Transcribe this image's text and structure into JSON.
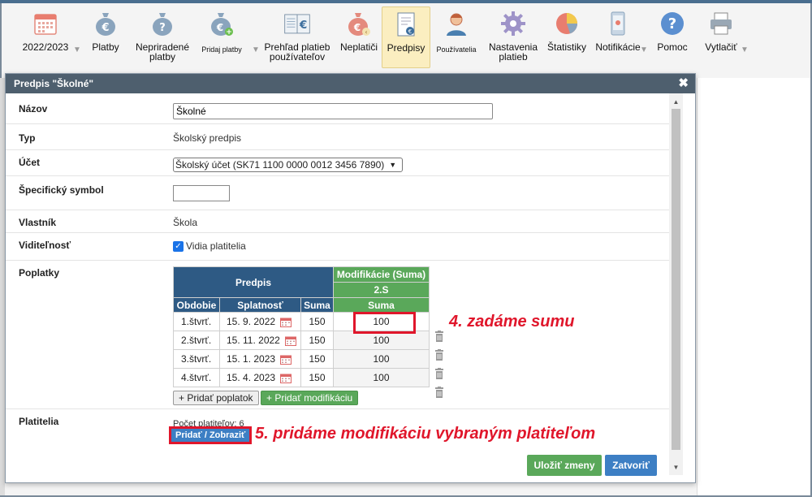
{
  "toolbar": {
    "items": [
      {
        "label": "2022/2023",
        "icon": "calendar-icon",
        "caret": true
      },
      {
        "label": "Platby",
        "icon": "money-bag-euro-icon"
      },
      {
        "label": "Nepriradené platby",
        "icon": "money-bag-question-icon"
      },
      {
        "label": "Pridaj platby",
        "icon": "money-bag-add-icon",
        "caret": true
      },
      {
        "label": "Prehľad platieb používateľov",
        "icon": "ledger-euro-icon"
      },
      {
        "label": "Neplatiči",
        "icon": "money-bag-back-icon"
      },
      {
        "label": "Predpisy",
        "icon": "document-euro-icon",
        "active": true
      },
      {
        "label": "Používatelia",
        "icon": "user-icon"
      },
      {
        "label": "Nastavenia platieb",
        "icon": "gear-icon"
      },
      {
        "label": "Štatistiky",
        "icon": "pie-chart-icon"
      },
      {
        "label": "Notifikácie",
        "icon": "phone-icon",
        "caret": true
      },
      {
        "label": "Pomoc",
        "icon": "help-icon"
      },
      {
        "label": "Vytlačiť",
        "icon": "printer-icon",
        "caret": true
      }
    ]
  },
  "dialog": {
    "title": "Predpis \"Školné\"",
    "close_glyph": "✖",
    "fields": {
      "name_label": "Názov",
      "name_value": "Školné",
      "type_label": "Typ",
      "type_value": "Školský predpis",
      "account_label": "Účet",
      "account_value": "Školský účet (SK71 1100 0000 0012 3456 7890)",
      "symbol_label": "Špecifický symbol",
      "symbol_value": "",
      "owner_label": "Vlastník",
      "owner_value": "Škola",
      "visibility_label": "Viditeľnosť",
      "visibility_value": "Vidia platitelia",
      "fees_label": "Poplatky",
      "payers_label": "Platitelia",
      "payers_count": "Počet platiteľov: 6"
    },
    "fees_table": {
      "group_header": "Predpis",
      "mod_header": "Modifikácie (Suma)",
      "mod_sub": "2.S",
      "columns": [
        "Obdobie",
        "Splatnosť",
        "Suma",
        "Suma"
      ],
      "rows": [
        {
          "period": "1.štvrť.",
          "due": "15. 9. 2022",
          "amount": "150",
          "mod": "100"
        },
        {
          "period": "2.štvrť.",
          "due": "15. 11. 2022",
          "amount": "150",
          "mod": "100"
        },
        {
          "period": "3.štvrť.",
          "due": "15. 1. 2023",
          "amount": "150",
          "mod": "100"
        },
        {
          "period": "4.štvrť.",
          "due": "15. 4. 2023",
          "amount": "150",
          "mod": "100"
        }
      ]
    },
    "buttons": {
      "add_fee": "+ Pridať poplatok",
      "add_mod": "+ Pridať modifikáciu",
      "add_show": "Pridať / Zobraziť",
      "save": "Uložiť zmeny",
      "close": "Zatvoriť"
    }
  },
  "annotations": {
    "step4": "4. zadáme sumu",
    "step5": "5. pridáme modifikáciu vybraným platiteľom"
  },
  "colors": {
    "accent_red": "#e0162b",
    "header_blue": "#2e5a84",
    "green": "#5aa85a",
    "button_blue": "#3d7fc4",
    "dialog_header": "#4e5f6e"
  }
}
